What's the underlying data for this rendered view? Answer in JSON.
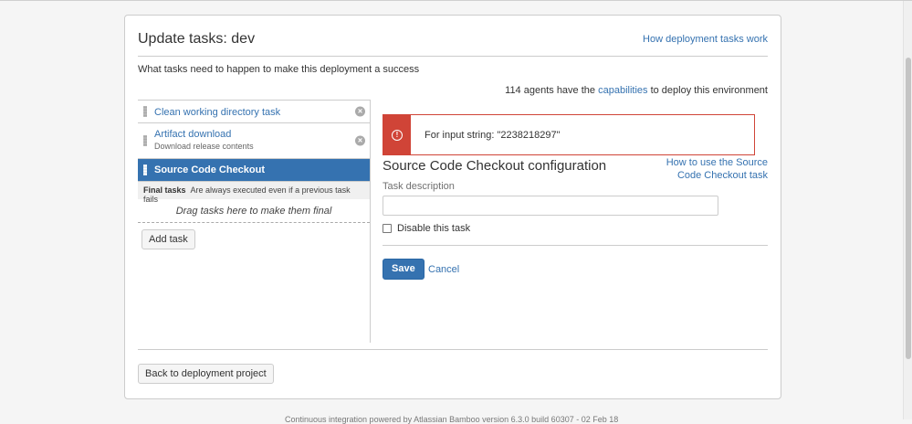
{
  "page": {
    "title": "Update tasks: dev",
    "help_link": "How deployment tasks work",
    "intro": "What tasks need to happen to make this deployment a success",
    "agents": {
      "prefix": "114 agents have the",
      "link": "capabilities",
      "suffix": "to deploy this environment"
    }
  },
  "tasks": [
    {
      "name": "Clean working directory task",
      "description": "",
      "remove_glyph": "×"
    },
    {
      "name": "Artifact download",
      "description": "Download release contents",
      "remove_glyph": "×"
    },
    {
      "name": "Source Code Checkout",
      "description": "",
      "selected": true
    }
  ],
  "final_tasks": {
    "label": "Final tasks",
    "note": "Are always executed even if a previous task fails",
    "drop_hint": "Drag tasks here to make them final"
  },
  "add_task_label": "Add task",
  "error": {
    "icon": "error-icon",
    "glyph": "!",
    "message": "For input string: \"2238218297\""
  },
  "config": {
    "title": "Source Code Checkout configuration",
    "howto_link": "How to use the Source Code Checkout task",
    "task_description_label": "Task description",
    "task_description_value": "",
    "disable_label": "Disable this task",
    "disable_checked": false,
    "save_label": "Save",
    "cancel_label": "Cancel"
  },
  "back_label": "Back to deployment project",
  "footer": "Continuous integration powered by Atlassian Bamboo version 6.3.0 build 60307 - 02 Feb 18",
  "colors": {
    "accent": "#3572b0",
    "error": "#d04437"
  }
}
